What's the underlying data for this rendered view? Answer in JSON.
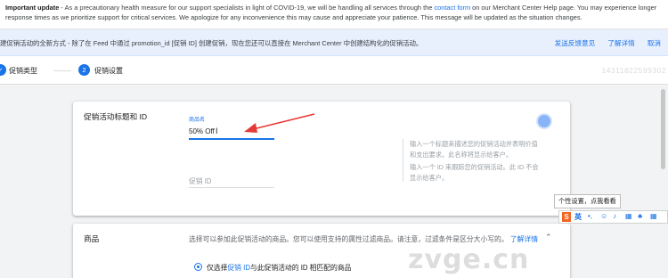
{
  "alert": {
    "title": "Important update",
    "text_before_link": " - As a precautionary health measure for our support specialists in light of COVID-19, we will be handling all services through the ",
    "link": "contact form",
    "text_after_link": " on our Merchant Center Help page. You may experience longer response times as we prioritize support for critical services. We apologize for any inconvenience this may cause and appreciate your patience. This message will be updated as the situation changes."
  },
  "banner": {
    "text": "建促销活动的全新方式 - 除了在 Feed 中通过 promotion_id [促销 ID] 创建促销，现在您还可以直接在 Merchant Center 中创建结构化的促销活动。",
    "send_feedback": "发送反馈意见",
    "learn_more": "了解详情",
    "dismiss": "取消"
  },
  "stepper": {
    "step1_label": "促销类型",
    "step2_number": "2",
    "step2_label": "促销设置",
    "bg_digits": "14311822599302"
  },
  "card1": {
    "title": "促销活动标题和 ID",
    "title_field_label": "商品名",
    "title_field_value": "50% Off",
    "id_placeholder": "促销 ID",
    "help_title": "输入一个标题来描述您的促销活动并表明价值和支出要求。此名称将显示给客户。",
    "help_id": "输入一个 ID 来跟踪您的促销活动。此 ID 不会显示给客户。"
  },
  "card2": {
    "title": "商品",
    "description": "选择可以参加此促销活动的商品。您可以使用支持的属性过滤商品。请注意，过滤条件是区分大小写的。",
    "learn_more": "了解详情",
    "radio_prefix": "仅选择",
    "radio_highlight": "促销 ID",
    "radio_suffix": "与此促销活动的 ID 相匹配的商品"
  },
  "overlay": {
    "tooltip": "个性设置，点我看看",
    "ime_logo": "S",
    "ime_lang": "英",
    "watermark": "zvge.cn"
  },
  "colors": {
    "primary": "#1a73e8",
    "banner_bg": "#e8f0fe",
    "arrow": "#e53935"
  },
  "icons": {
    "step1": "check-circle-icon",
    "cursor": "text-cursor-icon",
    "collapse": "chevron-up-icon"
  }
}
